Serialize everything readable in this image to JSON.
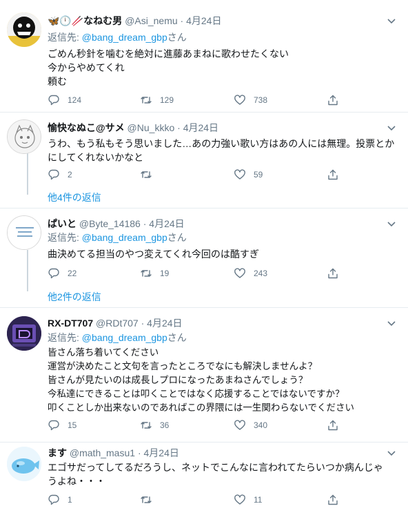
{
  "meta": {
    "reply_prefix": "返信先: ",
    "reply_suffix": "さん",
    "dot": "·"
  },
  "tweets": [
    {
      "name": "🦋🕛🥢なねむ男",
      "handle": "@Asi_nemu",
      "date": "4月24日",
      "reply_to": "@bang_dream_gbp",
      "body": "ごめん秒針を噛むを絶対に進藤あまねに歌わせたくない\n今からやめてくれ\n頼む",
      "replies": "124",
      "retweets": "129",
      "likes": "738",
      "more": ""
    },
    {
      "name": "愉快なぬこ@サメ",
      "handle": "@Nu_kkko",
      "date": "4月24日",
      "reply_to": "",
      "body": "うわ、もう私もそう思いました…あの力強い歌い方はあの人には無理。投票とかにしてくれないかなと",
      "replies": "2",
      "retweets": "",
      "likes": "59",
      "more": "他4件の返信"
    },
    {
      "name": "ぱいと",
      "handle": "@Byte_14186",
      "date": "4月24日",
      "reply_to": "@bang_dream_gbp",
      "body": "曲決めてる担当のやつ変えてくれ今回のは酷すぎ",
      "replies": "22",
      "retweets": "19",
      "likes": "243",
      "more": "他2件の返信"
    },
    {
      "name": "RX-DT707",
      "handle": "@RDt707",
      "date": "4月24日",
      "reply_to": "@bang_dream_gbp",
      "body": "皆さん落ち着いてください\n運営が決めたこと文句を言ったところでなにも解決しませんよ？\n皆さんが見たいのは成長しプロになったあまねさんでしょう？\n今私達にできることは叩くことではなく応援することではないですか？\n叩くことしか出来ないのであればこの界隈には一生関わらないでください",
      "replies": "15",
      "retweets": "36",
      "likes": "340",
      "more": ""
    },
    {
      "name": "ます",
      "handle": "@math_masu1",
      "date": "4月24日",
      "reply_to": "",
      "body": "エゴサだってしてるだろうし、ネットでこんなに言われてたらいつか病んじゃうよね・・・",
      "replies": "1",
      "retweets": "",
      "likes": "11",
      "more": ""
    }
  ],
  "colors": {
    "link": "#1b95e0",
    "muted": "#657786",
    "text": "#14171a",
    "divider": "#e6ecf0"
  },
  "icons": {
    "reply": "reply-icon",
    "retweet": "retweet-icon",
    "like": "heart-icon",
    "share": "share-icon",
    "menu": "chevron-down-icon"
  }
}
